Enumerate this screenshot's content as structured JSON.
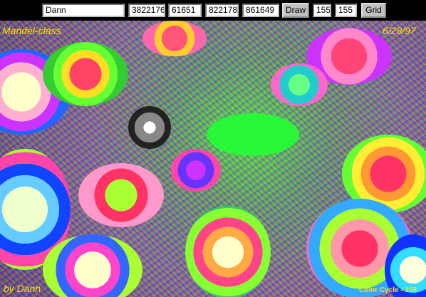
{
  "toolbar": {
    "name_value": "Dann",
    "param1_value": "3822176",
    "param2_value": "61651",
    "param3_value": "822178",
    "param4_value": "861649",
    "draw_label": "Draw",
    "param5_value": "155",
    "param6_value": "155",
    "grid_label": "Grid"
  },
  "canvas": {
    "title": "Mandel-class",
    "date": "6/28/97",
    "author": "by Dann",
    "color_cycle": "Color Cycle - 155"
  }
}
